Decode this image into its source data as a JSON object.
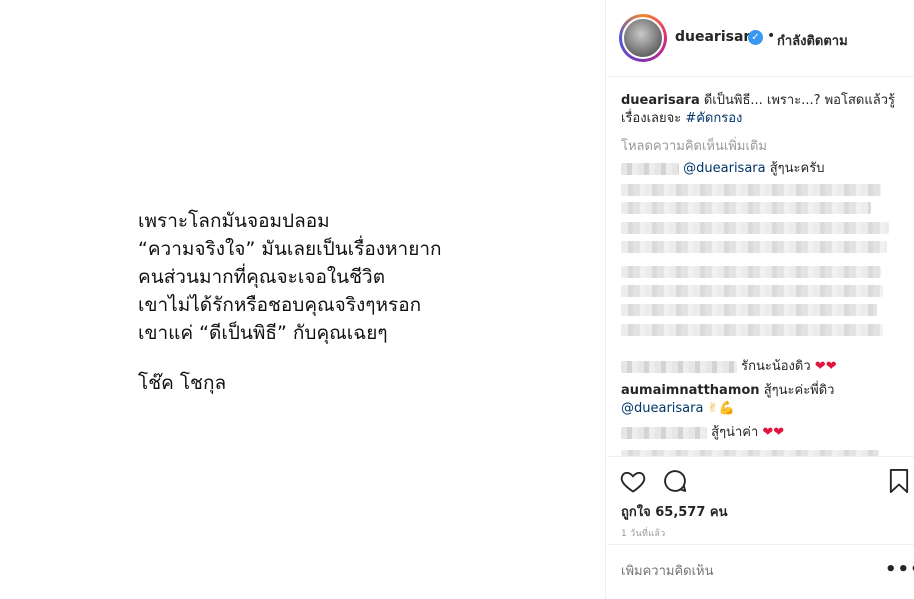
{
  "media": {
    "lines": [
      "เพราะโลกมันจอมปลอม",
      "“ความจริงใจ” มันเลยเป็นเรื่องหายาก",
      "คนส่วนมากที่คุณจะเจอในชีวิต",
      "เขาไม่ได้รักหรือชอบคุณจริงๆหรอก",
      "เขาแค่ “ดีเป็นพิธี” กับคุณเฉยๆ"
    ],
    "signature": "โช๊ค โชกุล"
  },
  "header": {
    "username": "duearisara",
    "dot": "•",
    "follow_status": "กำลังติดตาม",
    "verified_icon": "verified-badge"
  },
  "caption": {
    "username": "duearisara",
    "text": " ดีเป็นพิธี... เพราะ...? พอโสดแล้วรู้เรื่องเลยจะ ",
    "hashtag": "#คัดกรอง"
  },
  "load_more": "โหลดความคิดเห็นเพิ่มเติม",
  "comments": [
    {
      "mention": "@duearisara",
      "text": " สู้ๆนะครับ"
    },
    {
      "text": "รักนะน้องดิว"
    },
    {
      "username": "aumaimnatthamon",
      "text": " สู้ๆนะค่ะพี่ดิว",
      "mention": "@duearisara"
    },
    {
      "text": "สู้ๆน่าค่า"
    }
  ],
  "actions": {
    "likes": "ถูกใจ 65,577 คน",
    "time": "1 วันที่แล้ว",
    "add_comment_placeholder": "เพิ่มความคิดเห็น",
    "more": "•••"
  },
  "colors": {
    "heart": "#e0153b",
    "link": "#003569",
    "verified": "#3897f0"
  }
}
